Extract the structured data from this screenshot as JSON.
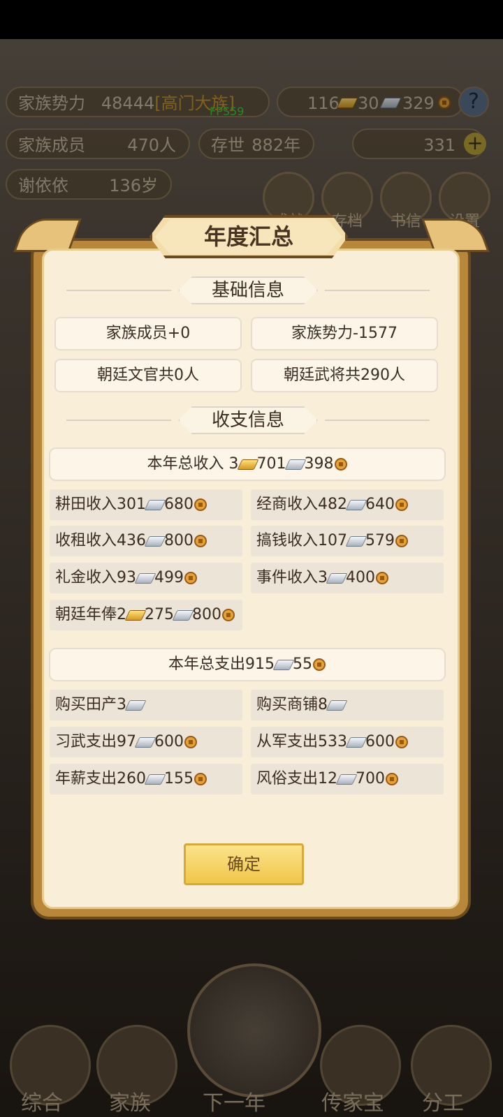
{
  "hud": {
    "power_label": "家族势力",
    "power_value": "48444",
    "power_rank": "[高门大族]",
    "fps": "FPS59",
    "res_gold": "116",
    "res_silver": "30",
    "res_coin": "329",
    "help": "?",
    "members_label": "家族成员",
    "members_value": "470人",
    "years_label": "存世",
    "years_value": "882年",
    "ingot_value": "331",
    "leader_name": "谢依依",
    "leader_age": "136岁",
    "icons": [
      "成就",
      "存档",
      "书信",
      "设置"
    ]
  },
  "dialog": {
    "title": "年度汇总",
    "basic_section": "基础信息",
    "basic_items": [
      "家族成员+0",
      "家族势力-1577",
      "朝廷文官共0人",
      "朝廷武将共290人"
    ],
    "finance_section": "收支信息",
    "income_total": {
      "label": "本年总收入",
      "gold": "3",
      "silver": "701",
      "coin": "398"
    },
    "income_items": [
      {
        "label": "耕田收入",
        "silver": "301",
        "coin": "680"
      },
      {
        "label": "经商收入",
        "silver": "482",
        "coin": "640"
      },
      {
        "label": "收租收入",
        "silver": "436",
        "coin": "800"
      },
      {
        "label": "搞钱收入",
        "silver": "107",
        "coin": "579"
      },
      {
        "label": "礼金收入",
        "silver": "93",
        "coin": "499"
      },
      {
        "label": "事件收入",
        "silver": "3",
        "coin": "400"
      },
      {
        "label": "朝廷年俸",
        "gold": "2",
        "silver": "275",
        "coin": "800"
      }
    ],
    "expense_total": {
      "label": "本年总支出",
      "silver": "915",
      "coin": "55"
    },
    "expense_items": [
      {
        "label": "购买田产",
        "silver": "3"
      },
      {
        "label": "购买商铺",
        "silver": "8"
      },
      {
        "label": "习武支出",
        "silver": "97",
        "coin": "600"
      },
      {
        "label": "从军支出",
        "silver": "533",
        "coin": "600"
      },
      {
        "label": "年薪支出",
        "silver": "260",
        "coin": "155"
      },
      {
        "label": "风俗支出",
        "silver": "12",
        "coin": "700"
      }
    ],
    "confirm": "确定"
  },
  "nav": [
    "综合",
    "家族",
    "下一年",
    "传家宝",
    "分工"
  ]
}
